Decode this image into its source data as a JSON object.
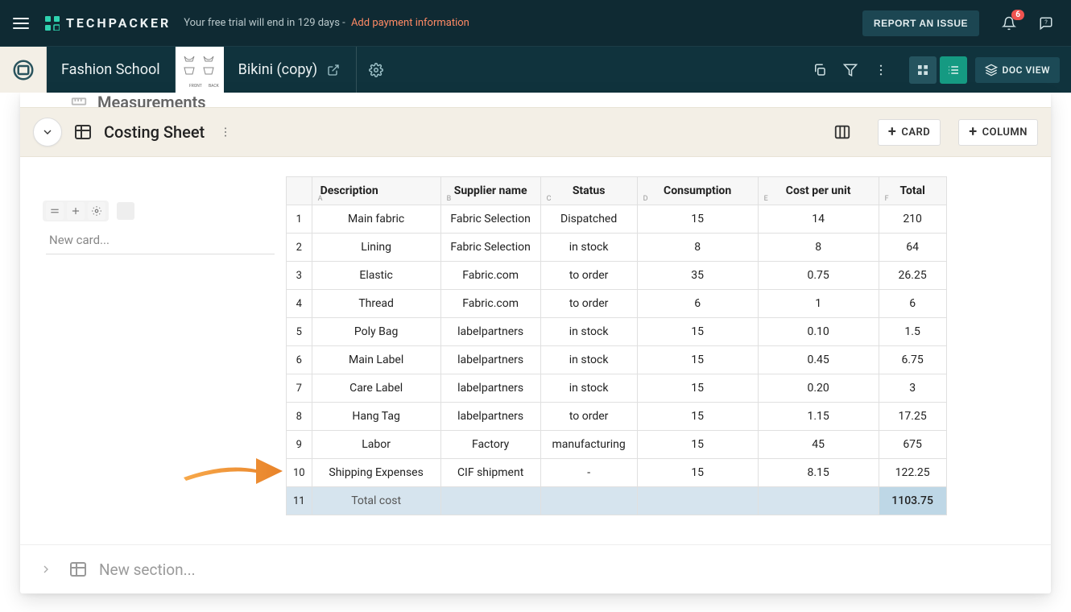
{
  "topbar": {
    "brand": "TECHPACKER",
    "trial_text": "Your free trial will end in 129 days",
    "trial_sep": " - ",
    "trial_cta": "Add payment information",
    "report_btn": "REPORT AN ISSUE",
    "notif_count": "6"
  },
  "context": {
    "workspace": "Fashion School",
    "style_name": "Bikini (copy)",
    "doc_view": "DOC VIEW"
  },
  "prev_section": {
    "title": "Measurements"
  },
  "section": {
    "title": "Costing Sheet",
    "card_btn": "CARD",
    "column_btn": "COLUMN"
  },
  "leftrail": {
    "new_card_placeholder": "New card..."
  },
  "table": {
    "headers": {
      "description": {
        "label": "Description",
        "letter": "A"
      },
      "supplier": {
        "label": "Supplier name",
        "letter": "B"
      },
      "status": {
        "label": "Status",
        "letter": "C"
      },
      "consumption": {
        "label": "Consumption",
        "letter": "D"
      },
      "cpu": {
        "label": "Cost per unit",
        "letter": "E"
      },
      "total": {
        "label": "Total",
        "letter": "F"
      }
    },
    "rows": [
      {
        "n": "1",
        "description": "Main fabric",
        "supplier": "Fabric Selection",
        "status": "Dispatched",
        "consumption": "15",
        "cpu": "14",
        "total": "210"
      },
      {
        "n": "2",
        "description": "Lining",
        "supplier": "Fabric Selection",
        "status": "in stock",
        "consumption": "8",
        "cpu": "8",
        "total": "64"
      },
      {
        "n": "3",
        "description": "Elastic",
        "supplier": "Fabric.com",
        "status": "to order",
        "consumption": "35",
        "cpu": "0.75",
        "total": "26.25"
      },
      {
        "n": "4",
        "description": "Thread",
        "supplier": "Fabric.com",
        "status": "to order",
        "consumption": "6",
        "cpu": "1",
        "total": "6"
      },
      {
        "n": "5",
        "description": "Poly Bag",
        "supplier": "labelpartners",
        "status": "in stock",
        "consumption": "15",
        "cpu": "0.10",
        "total": "1.5"
      },
      {
        "n": "6",
        "description": "Main Label",
        "supplier": "labelpartners",
        "status": "in stock",
        "consumption": "15",
        "cpu": "0.45",
        "total": "6.75"
      },
      {
        "n": "7",
        "description": "Care Label",
        "supplier": "labelpartners",
        "status": "in stock",
        "consumption": "15",
        "cpu": "0.20",
        "total": "3"
      },
      {
        "n": "8",
        "description": "Hang Tag",
        "supplier": "labelpartners",
        "status": "to order",
        "consumption": "15",
        "cpu": "1.15",
        "total": "17.25"
      },
      {
        "n": "9",
        "description": "Labor",
        "supplier": "Factory",
        "status": "manufacturing",
        "consumption": "15",
        "cpu": "45",
        "total": "675"
      },
      {
        "n": "10",
        "description": "Shipping Expenses",
        "supplier": "CIF shipment",
        "status": "-",
        "consumption": "15",
        "cpu": "8.15",
        "total": "122.25"
      }
    ],
    "total_row": {
      "n": "11",
      "label": "Total cost",
      "total": "1103.75"
    }
  },
  "new_section": {
    "placeholder": "New section..."
  }
}
